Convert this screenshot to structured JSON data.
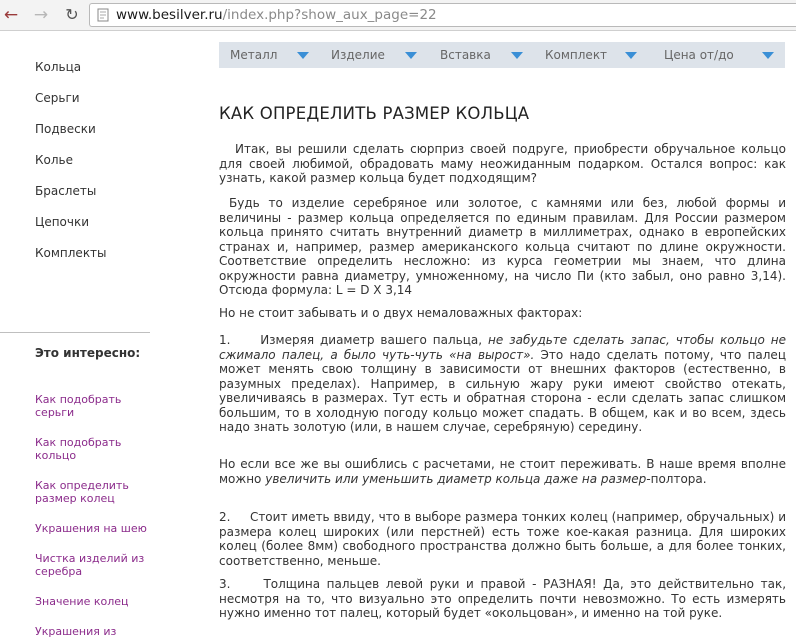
{
  "browser": {
    "url_host": "www.besilver.ru",
    "url_path": "/index.php?show_aux_page=22"
  },
  "sidebar": {
    "menu": [
      "Кольца",
      "Серьги",
      "Подвески",
      "Колье",
      "Браслеты",
      "Цепочки",
      "Комплекты"
    ],
    "interest_title": "Это интересно:",
    "links": [
      "Как подобрать серьги",
      "Как подобрать кольцо",
      "Как определить размер колец",
      "Украшения на шею",
      "Чистка изделий из серебра",
      "Значение колец",
      "Украшения из"
    ]
  },
  "filters": [
    "Металл",
    "Изделие",
    "Вставка",
    "Комплект",
    "Цена от/до"
  ],
  "article": {
    "title": "КАК ОПРЕДЕЛИТЬ РАЗМЕР КОЛЬЦА",
    "p1": "Итак, вы решили сделать сюрприз своей подруге, приобрести обручальное кольцо для своей любимой, обрадовать маму неожиданным подарком. Остался вопрос:  как узнать, какой размер кольца будет подходящим?",
    "p2": "Будь то изделие серебряное или золотое, с камнями или без, любой формы и величины - размер кольца определяется по единым правилам. Для России размером кольца принято считать внутренний диаметр в миллиметрах, однако в европейских странах и, например, размер американского кольца считают по длине окружности. Соответствие определить несложно: из курса геометрии мы знаем, что длина окружности равна диаметру, умноженному, на число Пи (кто забыл, оно равно 3,14). Отсюда формула: L = D X 3,14",
    "p3": "Но не стоит забывать и о двух немаловажных факторах:",
    "p4_num": "1.",
    "p4_lead": "Измеряя диаметр вашего пальца,",
    "p4_em": "не забудьте сделать запас, чтобы кольцо не сжимало палец, а было чуть-чуть «на вырост».",
    "p4_rest": "Это надо сделать потому, что палец может менять свою толщину в зависимости от внешних факторов (естественно, в разумных пределах). Например, в сильную жару руки имеют свойство отекать, увеличиваясь в размерах. Тут есть и обратная сторона - если сделать запас слишком большим, то в холодную погоду кольцо может спадать. В общем, как и во всем, здесь надо знать золотую (или, в нашем случае, серебряную) середину.",
    "p5_lead": "Но если все же вы ошиблись с расчетами, не стоит переживать. В наше время вполне можно",
    "p5_em": "увеличить или уменьшить диаметр кольца даже на размер-",
    "p5_rest": "полтора.",
    "p6_num": "2.",
    "p6_text": "Стоит иметь ввиду, что в выборе размера тонких колец (например, обручальных) и размера колец широких (или перстней) есть тоже кое-какая разница. Для широких колец (более 8мм) свободного пространства должно быть больше, а для более тонких, соответственно, меньше.",
    "p7_num": "3.",
    "p7_text": "Толщина пальцев левой руки и правой  - РАЗНАЯ! Да, это действительно так, несмотря на то, что визуально это определить почти невозможно. То есть измерять нужно именно тот палец, который будет «окольцован», и именно на той руке."
  }
}
